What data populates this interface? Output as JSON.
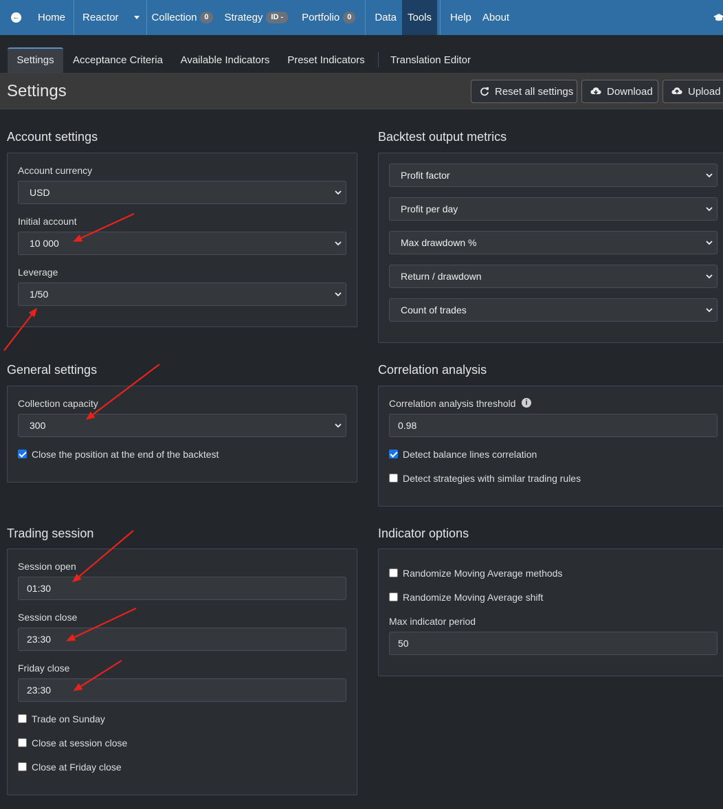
{
  "nav": {
    "home": "Home",
    "reactor": "Reactor",
    "collection": "Collection",
    "collection_count": "0",
    "strategy": "Strategy",
    "strategy_id": "ID -",
    "portfolio": "Portfolio",
    "portfolio_count": "0",
    "data": "Data",
    "tools": "Tools",
    "help": "Help",
    "about": "About"
  },
  "tabs": {
    "settings": "Settings",
    "acceptance": "Acceptance Criteria",
    "available": "Available Indicators",
    "preset": "Preset Indicators",
    "translation": "Translation Editor"
  },
  "page": {
    "title": "Settings",
    "reset_label": "Reset all settings",
    "download_label": "Download",
    "upload_label": "Upload"
  },
  "account": {
    "title": "Account settings",
    "currency_label": "Account currency",
    "currency_value": "USD",
    "initial_label": "Initial account",
    "initial_value": "10 000",
    "leverage_label": "Leverage",
    "leverage_value": "1/50"
  },
  "general": {
    "title": "General settings",
    "capacity_label": "Collection capacity",
    "capacity_value": "300",
    "close_end_label": "Close the position at the end of the backtest",
    "close_end_checked": true
  },
  "session": {
    "title": "Trading session",
    "open_label": "Session open",
    "open_value": "01:30",
    "close_label": "Session close",
    "close_value": "23:30",
    "friday_label": "Friday close",
    "friday_value": "23:30",
    "sunday_label": "Trade on Sunday",
    "close_session_label": "Close at session close",
    "close_friday_label": "Close at Friday close"
  },
  "metrics": {
    "title": "Backtest output metrics",
    "m1": "Profit factor",
    "m2": "Profit per day",
    "m3": "Max drawdown %",
    "m4": "Return / drawdown",
    "m5": "Count of trades"
  },
  "correlation": {
    "title": "Correlation analysis",
    "threshold_label": "Correlation analysis threshold",
    "threshold_value": "0.98",
    "balance_label": "Detect balance lines correlation",
    "balance_checked": true,
    "similar_label": "Detect strategies with similar trading rules"
  },
  "indicator": {
    "title": "Indicator options",
    "ma_methods_label": "Randomize Moving Average methods",
    "ma_shift_label": "Randomize Moving Average shift",
    "max_period_label": "Max indicator period",
    "max_period_value": "50"
  },
  "colors": {
    "nav_bg": "#2f6ea5",
    "nav_active": "#1c3f63",
    "page_bg": "#23262b",
    "panel_bg": "#2a2d32",
    "annotation_arrow": "#e8231c",
    "checkbox_checked": "#1a73e8"
  }
}
